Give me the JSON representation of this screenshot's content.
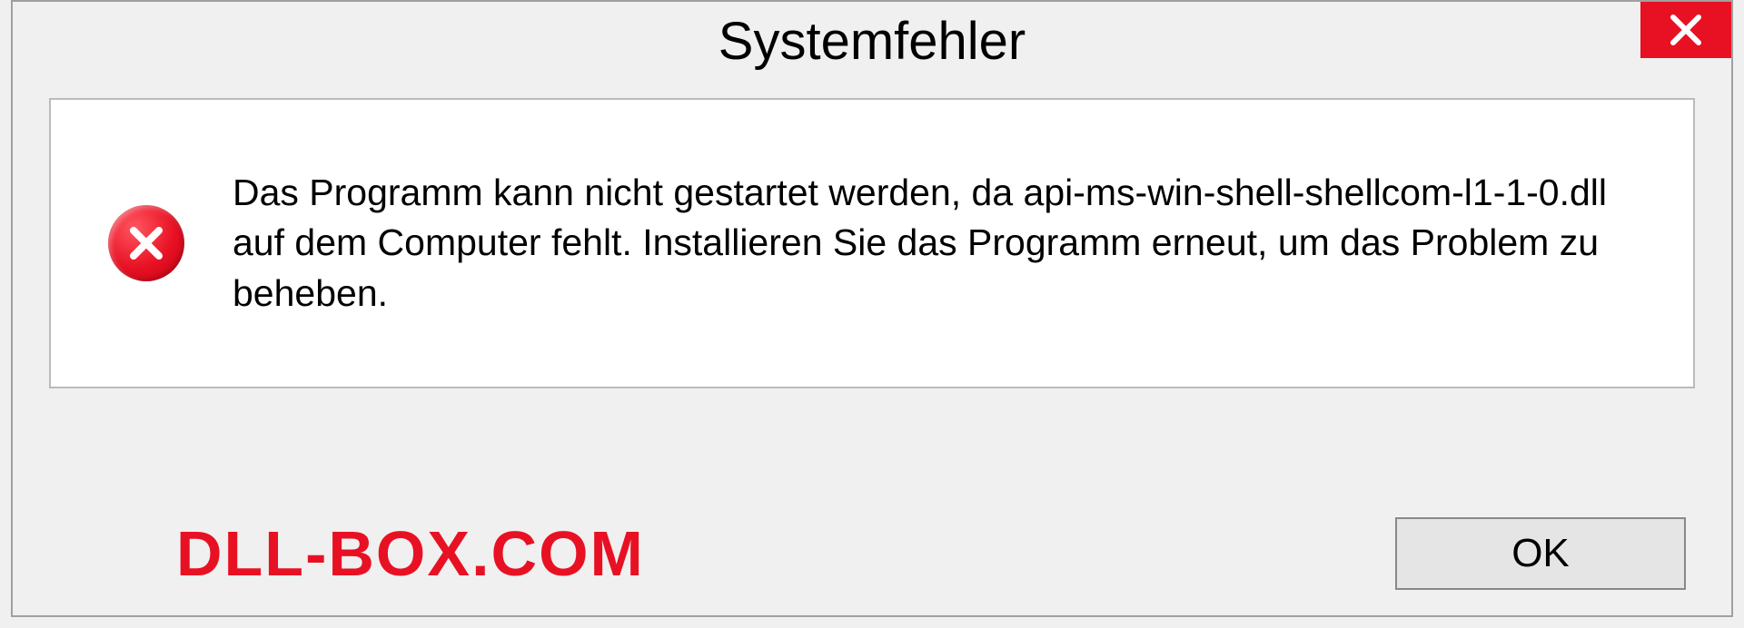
{
  "dialog": {
    "title": "Systemfehler",
    "message": "Das Programm kann nicht gestartet werden, da api-ms-win-shell-shellcom-l1-1-0.dll auf dem Computer fehlt. Installieren Sie das Programm erneut, um das Problem zu beheben.",
    "ok_label": "OK"
  },
  "watermark": "DLL-BOX.COM",
  "colors": {
    "error_red": "#e81123",
    "dialog_bg": "#f0f0f0",
    "content_bg": "#ffffff"
  }
}
